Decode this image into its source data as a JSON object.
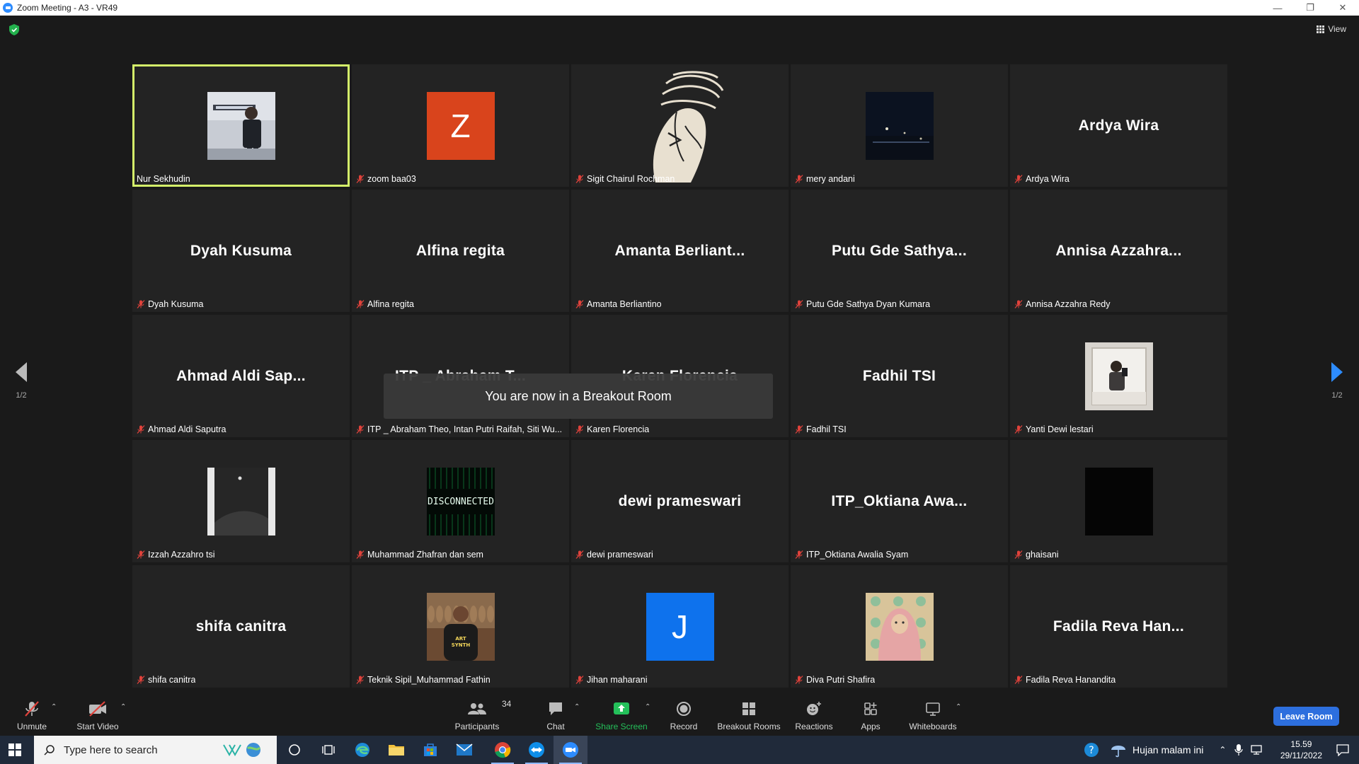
{
  "window": {
    "title": "Zoom Meeting - A3 - VR49",
    "minimize": "—",
    "restore": "❐",
    "close": "✕"
  },
  "view_label": "View",
  "tiles": [
    {
      "display": "",
      "label": "Nur Sekhudin",
      "muted": false,
      "thumb": "photo-person",
      "active": true
    },
    {
      "display": "",
      "label": "zoom baa03",
      "muted": true,
      "thumb": "letter",
      "letter": "Z",
      "color": "#d9441c"
    },
    {
      "display": "",
      "label": "Sigit Chairul Rochman",
      "muted": true,
      "thumb": "sketch"
    },
    {
      "display": "",
      "label": "mery andani",
      "muted": true,
      "thumb": "night-photo"
    },
    {
      "display": "Ardya Wira",
      "label": "Ardya Wira",
      "muted": true
    },
    {
      "display": "Dyah Kusuma",
      "label": "Dyah Kusuma",
      "muted": true
    },
    {
      "display": "Alfina regita",
      "label": "Alfina regita",
      "muted": true
    },
    {
      "display": "Amanta  Berliant...",
      "label": "Amanta Berliantino",
      "muted": true
    },
    {
      "display": "Putu Gde Sathya...",
      "label": "Putu Gde Sathya Dyan Kumara",
      "muted": true
    },
    {
      "display": "Annisa  Azzahra...",
      "label": "Annisa Azzahra Redy",
      "muted": true
    },
    {
      "display": "Ahmad  Aldi  Sap...",
      "label": "Ahmad Aldi Saputra",
      "muted": true
    },
    {
      "display": "ITP _ Abraham T...",
      "label": "ITP _ Abraham Theo, Intan Putri Raifah, Siti Wu...",
      "muted": true
    },
    {
      "display": "Karen Florencia",
      "label": "Karen Florencia",
      "muted": true
    },
    {
      "display": "Fadhil TSI",
      "label": "Fadhil TSI",
      "muted": true
    },
    {
      "display": "",
      "label": "Yanti Dewi lestari",
      "muted": true,
      "thumb": "mirror-photo"
    },
    {
      "display": "",
      "label": "Izzah Azzahro tsi",
      "muted": true,
      "thumb": "dark-photo"
    },
    {
      "display": "",
      "label": "Muhammad Zhafran dan sem",
      "muted": true,
      "thumb": "disconnected",
      "thumb_text": "DISCONNECTED"
    },
    {
      "display": "dewi prameswari",
      "label": "dewi prameswari",
      "muted": true
    },
    {
      "display": "ITP_Oktiana  Awa...",
      "label": "ITP_Oktiana Awalia Syam",
      "muted": true
    },
    {
      "display": "",
      "label": "ghaisani",
      "muted": true,
      "thumb": "black"
    },
    {
      "display": "shifa canitra",
      "label": "shifa canitra",
      "muted": true
    },
    {
      "display": "",
      "label": "Teknik Sipil_Muhammad Fathin",
      "muted": true,
      "thumb": "shirt-photo",
      "shirt_text": "ART SYNTH"
    },
    {
      "display": "",
      "label": "Jihan maharani",
      "muted": true,
      "thumb": "letter",
      "letter": "J",
      "color": "#0e72ed"
    },
    {
      "display": "",
      "label": "Diva Putri Shafira",
      "muted": true,
      "thumb": "hijab-photo"
    },
    {
      "display": "Fadila  Reva  Han...",
      "label": "Fadila Reva Hanandita",
      "muted": true
    }
  ],
  "pager": {
    "left": "1/2",
    "right": "1/2"
  },
  "toast": "You are now in a Breakout Room",
  "toolbar": {
    "unmute": "Unmute",
    "start_video": "Start Video",
    "participants": "Participants",
    "participants_count": "34",
    "chat": "Chat",
    "share_screen": "Share Screen",
    "record": "Record",
    "breakout_rooms": "Breakout Rooms",
    "reactions": "Reactions",
    "apps": "Apps",
    "whiteboards": "Whiteboards",
    "leave": "Leave Room"
  },
  "taskbar": {
    "search_placeholder": "Type here to search",
    "weather": "Hujan malam ini",
    "time": "15.59",
    "date": "29/11/2022"
  },
  "colors": {
    "active_border": "#d4f16a",
    "share_green": "#24c05a",
    "leave_blue": "#2d6fde",
    "mute_red": "#e0423b"
  }
}
